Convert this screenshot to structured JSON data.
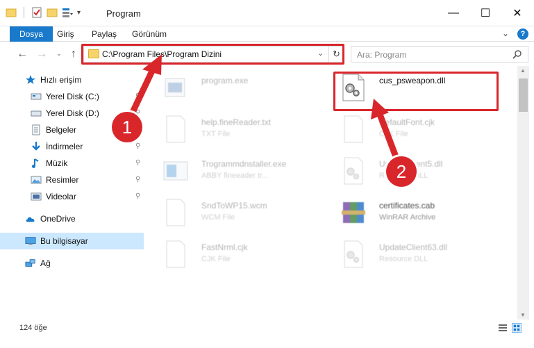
{
  "window": {
    "title": "Program",
    "min_glyph": "—",
    "max_glyph": "☐",
    "close_glyph": "✕"
  },
  "ribbon": {
    "tabs": [
      "Dosya",
      "Giriş",
      "Paylaş",
      "Görünüm"
    ],
    "expand_glyph": "⌄",
    "help_glyph": "?"
  },
  "address_bar": {
    "path": "C:\\Program Files\\Program Dizini",
    "dropdown_glyph": "⌄",
    "refresh_glyph": "↻"
  },
  "nav_buttons": {
    "back": "←",
    "forward": "→",
    "recent": "⌄",
    "up": "↑"
  },
  "search": {
    "placeholder": "Ara: Program"
  },
  "sidebar": {
    "items": [
      {
        "label": "Hızlı erişim",
        "icon": "star-icon"
      },
      {
        "label": "Yerel Disk (C:)",
        "icon": "drive-icon",
        "pinned": true
      },
      {
        "label": "Yerel Disk (D:)",
        "icon": "drive-icon",
        "pinned": true
      },
      {
        "label": "Belgeler",
        "icon": "documents-icon",
        "pinned": true
      },
      {
        "label": "İndirmeler",
        "icon": "download-icon",
        "pinned": true
      },
      {
        "label": "Müzik",
        "icon": "music-icon",
        "pinned": true
      },
      {
        "label": "Resimler",
        "icon": "pictures-icon",
        "pinned": true
      },
      {
        "label": "Videolar",
        "icon": "videos-icon",
        "pinned": true
      },
      {
        "label": "OneDrive",
        "icon": "cloud-icon"
      },
      {
        "label": "Bu bilgisayar",
        "icon": "computer-icon",
        "selected": true
      },
      {
        "label": "Ağ",
        "icon": "network-icon"
      }
    ],
    "pin_glyph": "📌"
  },
  "files": [
    {
      "name": "program.exe",
      "type": "",
      "icon": "exe-icon",
      "faded": true
    },
    {
      "name": "cus_psweapon.dll",
      "type": "",
      "icon": "dll-icon",
      "faded": false
    },
    {
      "name": "help.fineReader.txt",
      "type": "TXT File",
      "icon": "text-file-icon",
      "faded": true
    },
    {
      "name": "DefaultFont.cjk",
      "type": "CJK File",
      "icon": "blank-file-icon",
      "faded": true
    },
    {
      "name": "Trogrammdnstaller.exe",
      "type": "ABBY fineeader tr...",
      "icon": "exe-icon",
      "faded": true
    },
    {
      "name": "UpdateClient5.dll",
      "type": "Resource DLL",
      "icon": "dll-icon",
      "faded": true
    },
    {
      "name": "SndToWP15.wcm",
      "type": "WCM File",
      "icon": "blank-file-icon",
      "faded": true
    },
    {
      "name": "certificates.cab",
      "type": "WinRAR Archive",
      "icon": "archive-icon",
      "faded": true
    },
    {
      "name": "FastNrml.cjk",
      "type": "CJK File",
      "icon": "blank-file-icon",
      "faded": true
    },
    {
      "name": "UpdateClient63.dll",
      "type": "Resource DLL",
      "icon": "dll-icon",
      "faded": true
    }
  ],
  "status": {
    "item_count": "124 öğe"
  },
  "annotations": {
    "step1": "1",
    "step2": "2"
  },
  "colors": {
    "accent": "#1979ca",
    "highlight_red": "#d9262b",
    "selected_bg": "#cce8ff"
  }
}
